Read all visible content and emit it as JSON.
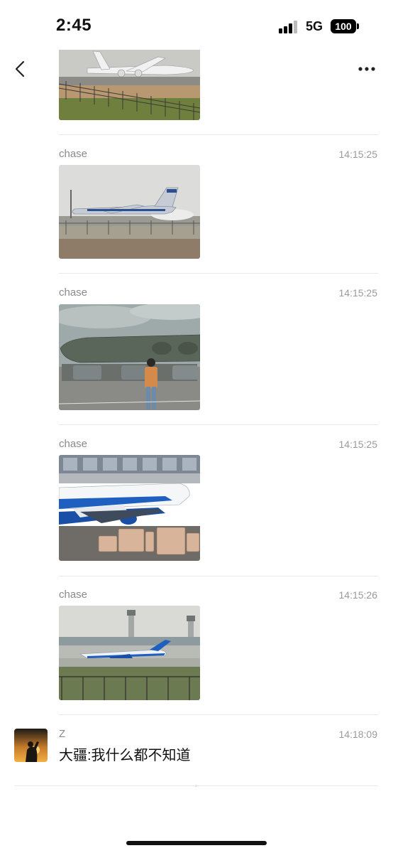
{
  "status_bar": {
    "time": "2:45",
    "network": "5G",
    "battery": "100"
  },
  "header": {
    "back_icon": "chevron-left-icon",
    "more_icon": "more-horizontal-icon"
  },
  "messages": [
    {
      "sender": "chase",
      "time": "14:15:25",
      "watermark": ""
    },
    {
      "sender": "chase",
      "time": "14:15:25",
      "watermark": ""
    },
    {
      "sender": "chase",
      "time": "14:15:25",
      "watermark": ""
    },
    {
      "sender": "chase",
      "time": "14:15:26",
      "watermark": ""
    }
  ],
  "first_photo": {
    "watermark": ""
  },
  "last_message": {
    "sender": "Z",
    "time": "14:18:09",
    "text": "大疆:我什么都不知道"
  },
  "colors": {
    "accent_blue": "#1f5fbf",
    "background": "#ffffff",
    "divider": "#e9e9e9",
    "meta_gray": "#9a9a9a"
  }
}
